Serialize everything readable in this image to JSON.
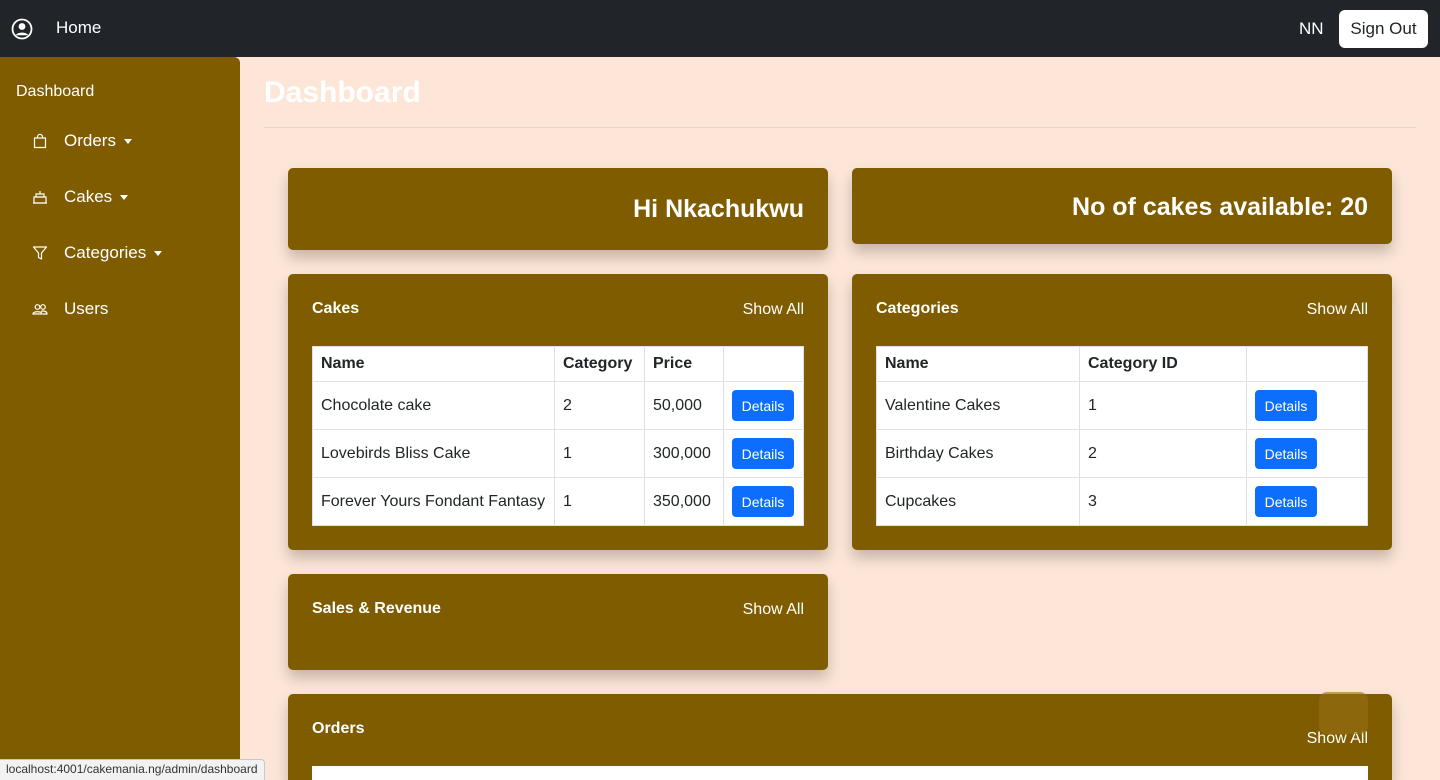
{
  "topbar": {
    "home": "Home",
    "initials": "NN",
    "sign_out": "Sign Out"
  },
  "sidebar": {
    "title": "Dashboard",
    "items": [
      {
        "label": "Orders",
        "icon": "bag-icon",
        "dropdown": true
      },
      {
        "label": "Cakes",
        "icon": "cake-icon",
        "dropdown": true
      },
      {
        "label": "Categories",
        "icon": "funnel-icon",
        "dropdown": true
      },
      {
        "label": "Users",
        "icon": "people-icon",
        "dropdown": false
      }
    ]
  },
  "main": {
    "title": "Dashboard",
    "greeting": "Hi Nkachukwu",
    "cakes_available": "No of cakes available: 20",
    "cakes": {
      "title": "Cakes",
      "show_all": "Show All",
      "columns": [
        "Name",
        "Category",
        "Price",
        ""
      ],
      "rows": [
        {
          "name": "Chocolate cake",
          "category": "2",
          "price": "50,000",
          "action": "Details"
        },
        {
          "name": "Lovebirds Bliss Cake",
          "category": "1",
          "price": "300,000",
          "action": "Details"
        },
        {
          "name": "Forever Yours Fondant Fantasy",
          "category": "1",
          "price": "350,000",
          "action": "Details"
        }
      ]
    },
    "categories": {
      "title": "Categories",
      "show_all": "Show All",
      "columns": [
        "Name",
        "Category ID",
        ""
      ],
      "rows": [
        {
          "name": "Valentine Cakes",
          "id": "1",
          "action": "Details"
        },
        {
          "name": "Birthday Cakes",
          "id": "2",
          "action": "Details"
        },
        {
          "name": "Cupcakes",
          "id": "3",
          "action": "Details"
        }
      ]
    },
    "sales": {
      "title": "Sales & Revenue",
      "show_all": "Show All"
    },
    "orders": {
      "title": "Orders",
      "show_all": "Show All"
    }
  },
  "status_bar": "localhost:4001/cakemania.ng/admin/dashboard",
  "colors": {
    "brand": "#7f5c00",
    "page_bg": "#fde6d8",
    "nav_bg": "#212529",
    "primary": "#0d6efd"
  }
}
